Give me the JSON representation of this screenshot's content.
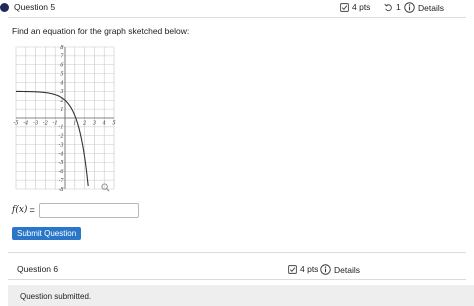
{
  "question5": {
    "title": "Question 5",
    "points": "4 pts",
    "attempts": "1",
    "details": "Details"
  },
  "prompt": "Find an equation for the graph sketched below:",
  "graph": {
    "x_ticks": [
      "-5",
      "-4",
      "-3",
      "-2",
      "-1",
      "1",
      "2",
      "3",
      "4",
      "5"
    ],
    "y_ticks": [
      "8",
      "7",
      "6",
      "5",
      "4",
      "3",
      "2",
      "1",
      "-1",
      "-2",
      "-3",
      "-4",
      "-5",
      "-6",
      "-7",
      "-8"
    ],
    "xlim": [
      -5,
      5
    ],
    "ylim": [
      -8,
      8
    ],
    "curve_color": "#333333",
    "grid_color": "#c8c8c8",
    "magnifier_icon": "magnifier-icon"
  },
  "answer": {
    "label_fx": "f(x)",
    "label_eq": "=",
    "value": "",
    "placeholder": ""
  },
  "submit_label": "Submit Question",
  "question6": {
    "title": "Question 6",
    "points": "4 pts",
    "details": "Details"
  },
  "status": "Question submitted.",
  "colors": {
    "accent": "#2a77c9",
    "dot": "#1f2a57"
  }
}
